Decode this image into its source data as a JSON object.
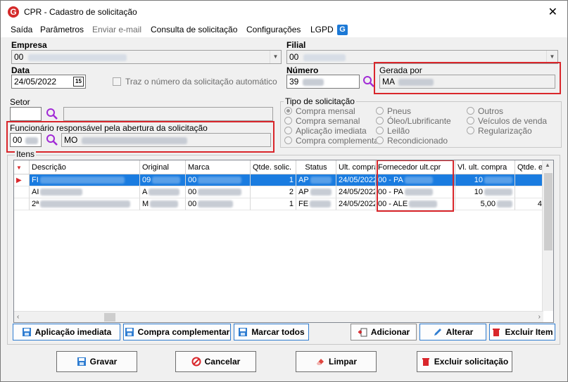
{
  "window": {
    "title": "CPR - Cadastro de solicitação",
    "logo_letter": "G",
    "close_glyph": "✕"
  },
  "menu": {
    "items": [
      "Saída",
      "Parâmetros",
      "Enviar e-mail",
      "Consulta de solicitação",
      "Configurações",
      "LGPD"
    ],
    "lgpd_icon_letter": "G"
  },
  "form": {
    "empresa_label": "Empresa",
    "empresa_value": "00",
    "filial_label": "Filial",
    "filial_value": "00",
    "data_label": "Data",
    "data_value": "24/05/2022",
    "calendar_glyph": "15",
    "auto_number_label": "Traz o número da solicitação automático",
    "numero_label": "Número",
    "numero_value": "39",
    "gerada_por_label": "Gerada por",
    "gerada_por_value": "MA",
    "setor_label": "Setor",
    "funcionario_label": "Funcionário responsável pela abertura da solicitação",
    "funcionario_code": "00",
    "funcionario_name": "MO"
  },
  "tipo": {
    "title": "Tipo de solicitação",
    "options": [
      "Compra mensal",
      "Compra semanal",
      "Aplicação imediata",
      "Compra complementar",
      "Pneus",
      "Óleo/Lubrificante",
      "Leilão",
      "Recondicionado",
      "Outros",
      "Veículos de venda",
      "Regularização"
    ],
    "selected": "Compra mensal"
  },
  "itens": {
    "title": "Itens",
    "columns": [
      "Descrição",
      "Original",
      "Marca",
      "Qtde. solic.",
      "Status",
      "Ult. compra",
      "Fornecedor ult.cpr",
      "Vl. ult. compra",
      "Qtde. es"
    ],
    "rows": [
      {
        "desc": "FI",
        "original": "09",
        "marca": "00",
        "qtde": "1",
        "status": "AP",
        "ult": "24/05/2022",
        "forn": "00 - PA",
        "vl": "10"
      },
      {
        "desc": "AI",
        "original": "A",
        "marca": "00",
        "qtde": "2",
        "status": "AP",
        "ult": "24/05/2022",
        "forn": "00 - PA",
        "vl": "10"
      },
      {
        "desc": "2ª",
        "original": "M",
        "marca": "00",
        "qtde": "1",
        "status": "FE",
        "ult": "24/05/2022",
        "forn": "00 - ALE",
        "vl": "5,00",
        "extra": "4"
      }
    ]
  },
  "buttons": {
    "aplicacao": "Aplicação imediata",
    "compra_comp": "Compra complementar",
    "marcar": "Marcar todos",
    "adicionar": "Adicionar",
    "alterar": "Alterar",
    "excluir_item": "Excluir Item",
    "gravar": "Gravar",
    "cancelar": "Cancelar",
    "limpar": "Limpar",
    "excluir_solic": "Excluir solicitação"
  },
  "colors": {
    "highlight_red": "#d9262b",
    "selection_blue": "#1a7ce0",
    "accent_blue": "#2f7dd1"
  }
}
